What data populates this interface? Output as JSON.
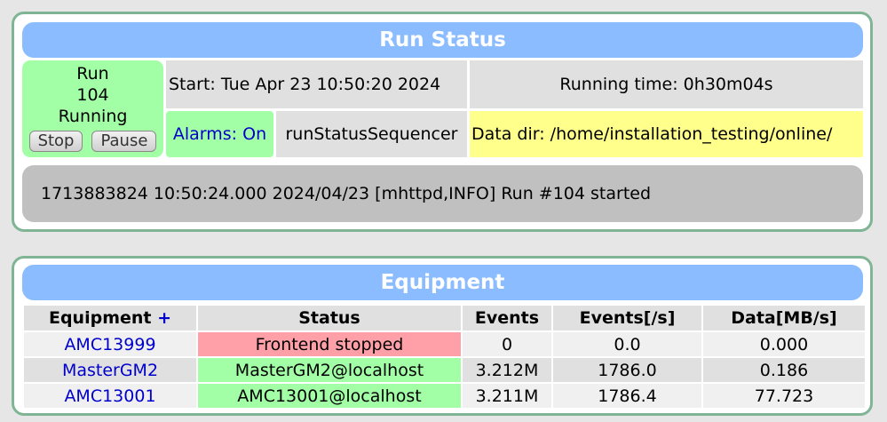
{
  "run_status": {
    "title": "Run Status",
    "run_label": "Run",
    "run_number": "104",
    "state": "Running",
    "stop_label": "Stop",
    "pause_label": "Pause",
    "start_time": "Start: Tue Apr 23 10:50:20 2024",
    "running_time": "Running time: 0h30m04s",
    "alarms": "Alarms: On",
    "sequencer": "runStatusSequencer",
    "data_dir": "Data dir: /home/installation_testing/online/",
    "message": "1713883824 10:50:24.000 2024/04/23 [mhttpd,INFO] Run #104 started",
    "colors": {
      "running": "#a2ffa6",
      "data_dir": "#ffff8c",
      "header": "#8bbcff"
    }
  },
  "equipment": {
    "title": "Equipment",
    "columns": [
      "Equipment",
      "Status",
      "Events",
      "Events[/s]",
      "Data[MB/s]"
    ],
    "add_symbol": "+",
    "rows": [
      {
        "name": "AMC13999",
        "status": "Frontend stopped",
        "status_color": "#ffa0a8",
        "events": "0",
        "rate": "0.0",
        "data": "0.000"
      },
      {
        "name": "MasterGM2",
        "status": "MasterGM2@localhost",
        "status_color": "#a2ffa6",
        "events": "3.212M",
        "rate": "1786.0",
        "data": "0.186"
      },
      {
        "name": "AMC13001",
        "status": "AMC13001@localhost",
        "status_color": "#a2ffa6",
        "events": "3.211M",
        "rate": "1786.4",
        "data": "77.723"
      }
    ]
  }
}
